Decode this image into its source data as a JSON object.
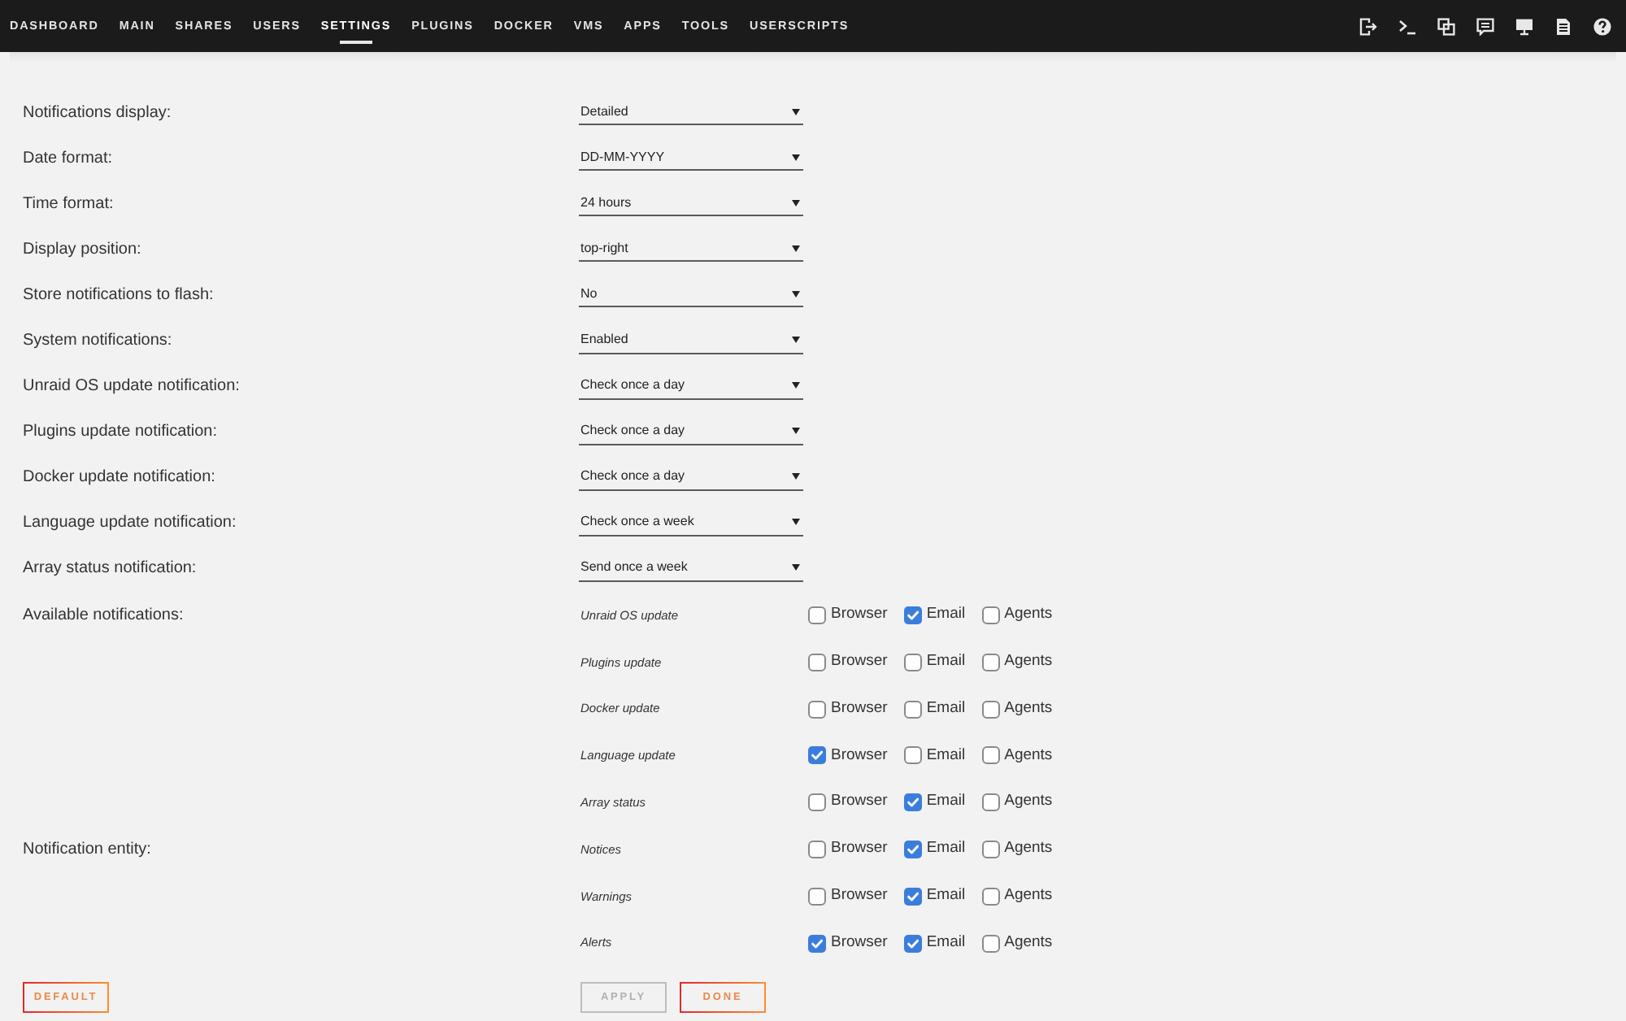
{
  "nav": {
    "items": [
      {
        "label": "DASHBOARD",
        "selected": false
      },
      {
        "label": "MAIN",
        "selected": false
      },
      {
        "label": "SHARES",
        "selected": false
      },
      {
        "label": "USERS",
        "selected": false
      },
      {
        "label": "SETTINGS",
        "selected": true
      },
      {
        "label": "PLUGINS",
        "selected": false
      },
      {
        "label": "DOCKER",
        "selected": false
      },
      {
        "label": "VMS",
        "selected": false
      },
      {
        "label": "APPS",
        "selected": false
      },
      {
        "label": "TOOLS",
        "selected": false
      },
      {
        "label": "USERSCRIPTS",
        "selected": false
      }
    ]
  },
  "settings": [
    {
      "label": "Notifications display:",
      "value": "Detailed"
    },
    {
      "label": "Date format:",
      "value": "DD-MM-YYYY"
    },
    {
      "label": "Time format:",
      "value": "24 hours"
    },
    {
      "label": "Display position:",
      "value": "top-right"
    },
    {
      "label": "Store notifications to flash:",
      "value": "No"
    },
    {
      "label": "System notifications:",
      "value": "Enabled"
    },
    {
      "label": "Unraid OS update notification:",
      "value": "Check once a day"
    },
    {
      "label": "Plugins update notification:",
      "value": "Check once a day"
    },
    {
      "label": "Docker update notification:",
      "value": "Check once a day"
    },
    {
      "label": "Language update notification:",
      "value": "Check once a week"
    },
    {
      "label": "Array status notification:",
      "value": "Send once a week"
    }
  ],
  "notification_groups": [
    {
      "label": "Available notifications:",
      "rows": [
        {
          "label": "Unraid OS update",
          "options": [
            {
              "label": "Browser",
              "checked": false
            },
            {
              "label": "Email",
              "checked": true
            },
            {
              "label": "Agents",
              "checked": false
            }
          ]
        },
        {
          "label": "Plugins update",
          "options": [
            {
              "label": "Browser",
              "checked": false
            },
            {
              "label": "Email",
              "checked": false
            },
            {
              "label": "Agents",
              "checked": false
            }
          ]
        },
        {
          "label": "Docker update",
          "options": [
            {
              "label": "Browser",
              "checked": false
            },
            {
              "label": "Email",
              "checked": false
            },
            {
              "label": "Agents",
              "checked": false
            }
          ]
        },
        {
          "label": "Language update",
          "options": [
            {
              "label": "Browser",
              "checked": true
            },
            {
              "label": "Email",
              "checked": false
            },
            {
              "label": "Agents",
              "checked": false
            }
          ]
        },
        {
          "label": "Array status",
          "options": [
            {
              "label": "Browser",
              "checked": false
            },
            {
              "label": "Email",
              "checked": true
            },
            {
              "label": "Agents",
              "checked": false
            }
          ]
        }
      ]
    },
    {
      "label": "Notification entity:",
      "rows": [
        {
          "label": "Notices",
          "options": [
            {
              "label": "Browser",
              "checked": false
            },
            {
              "label": "Email",
              "checked": true
            },
            {
              "label": "Agents",
              "checked": false
            }
          ]
        },
        {
          "label": "Warnings",
          "options": [
            {
              "label": "Browser",
              "checked": false
            },
            {
              "label": "Email",
              "checked": true
            },
            {
              "label": "Agents",
              "checked": false
            }
          ]
        },
        {
          "label": "Alerts",
          "options": [
            {
              "label": "Browser",
              "checked": true
            },
            {
              "label": "Email",
              "checked": true
            },
            {
              "label": "Agents",
              "checked": false
            }
          ]
        }
      ]
    }
  ],
  "footer": {
    "left": [
      {
        "label": "DEFAULT",
        "disabled": false
      }
    ],
    "right": [
      {
        "label": "APPLY",
        "disabled": true
      },
      {
        "label": "DONE",
        "disabled": false
      }
    ]
  }
}
